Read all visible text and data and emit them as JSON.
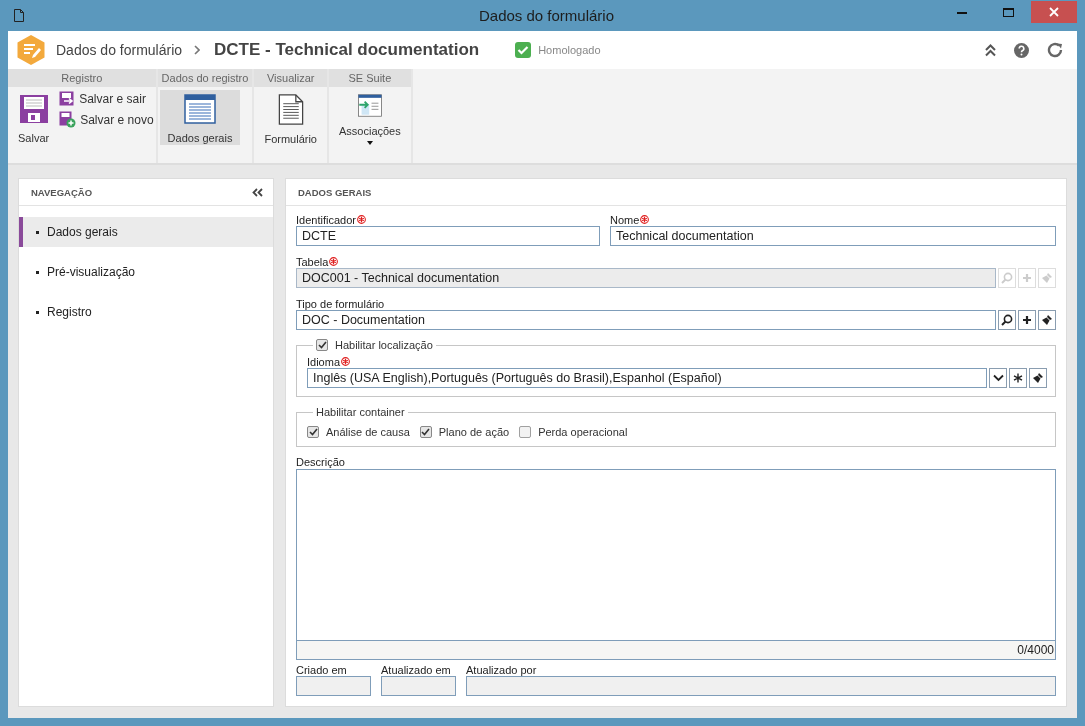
{
  "window": {
    "title": "Dados do formulário"
  },
  "header": {
    "breadcrumb": "Dados do formulário",
    "title": "DCTE - Technical documentation",
    "status": {
      "label": "Homologado",
      "approved": true
    }
  },
  "ribbon": {
    "groups": [
      {
        "title": "Registro",
        "buttons": [
          {
            "kind": "large",
            "label": "Salvar",
            "selected": false,
            "dropdown": false
          },
          {
            "kind": "small",
            "label": "Salvar e sair"
          },
          {
            "kind": "small",
            "label": "Salvar e novo"
          }
        ]
      },
      {
        "title": "Dados do registro",
        "buttons": [
          {
            "kind": "large",
            "label": "Dados gerais",
            "selected": true,
            "dropdown": false
          }
        ]
      },
      {
        "title": "Visualizar",
        "buttons": [
          {
            "kind": "large",
            "label": "Formulário",
            "selected": false,
            "dropdown": false
          }
        ]
      },
      {
        "title": "SE Suite",
        "buttons": [
          {
            "kind": "large",
            "label": "Associações",
            "selected": false,
            "dropdown": true
          }
        ]
      }
    ]
  },
  "navigation": {
    "title": "NAVEGAÇÃO",
    "items": [
      {
        "label": "Dados gerais",
        "selected": true
      },
      {
        "label": "Pré-visualização",
        "selected": false
      },
      {
        "label": "Registro",
        "selected": false
      }
    ]
  },
  "panel": {
    "title": "DADOS GERAIS",
    "identifier": {
      "label": "Identificador",
      "required": true,
      "value": "DCTE"
    },
    "name": {
      "label": "Nome",
      "required": true,
      "value": "Technical documentation"
    },
    "table": {
      "label": "Tabela",
      "required": true,
      "value": "DOC001 - Technical documentation",
      "disabled": true
    },
    "form_type": {
      "label": "Tipo de formulário",
      "required": false,
      "value": "DOC - Documentation",
      "disabled": false
    },
    "localization": {
      "label": "Habilitar localização",
      "checked": true,
      "language": {
        "label": "Idioma",
        "required": true,
        "value": "Inglês (USA English),Português (Português do Brasil),Espanhol (Español)"
      }
    },
    "container": {
      "label": "Habilitar container",
      "options": [
        {
          "label": "Análise de causa",
          "checked": true
        },
        {
          "label": "Plano de ação",
          "checked": true
        },
        {
          "label": "Perda operacional",
          "checked": false
        }
      ]
    },
    "description": {
      "label": "Descrição",
      "counter": "0/4000"
    },
    "footer_fields": [
      {
        "label": "Criado em"
      },
      {
        "label": "Atualizado em"
      },
      {
        "label": "Atualizado por"
      }
    ]
  }
}
